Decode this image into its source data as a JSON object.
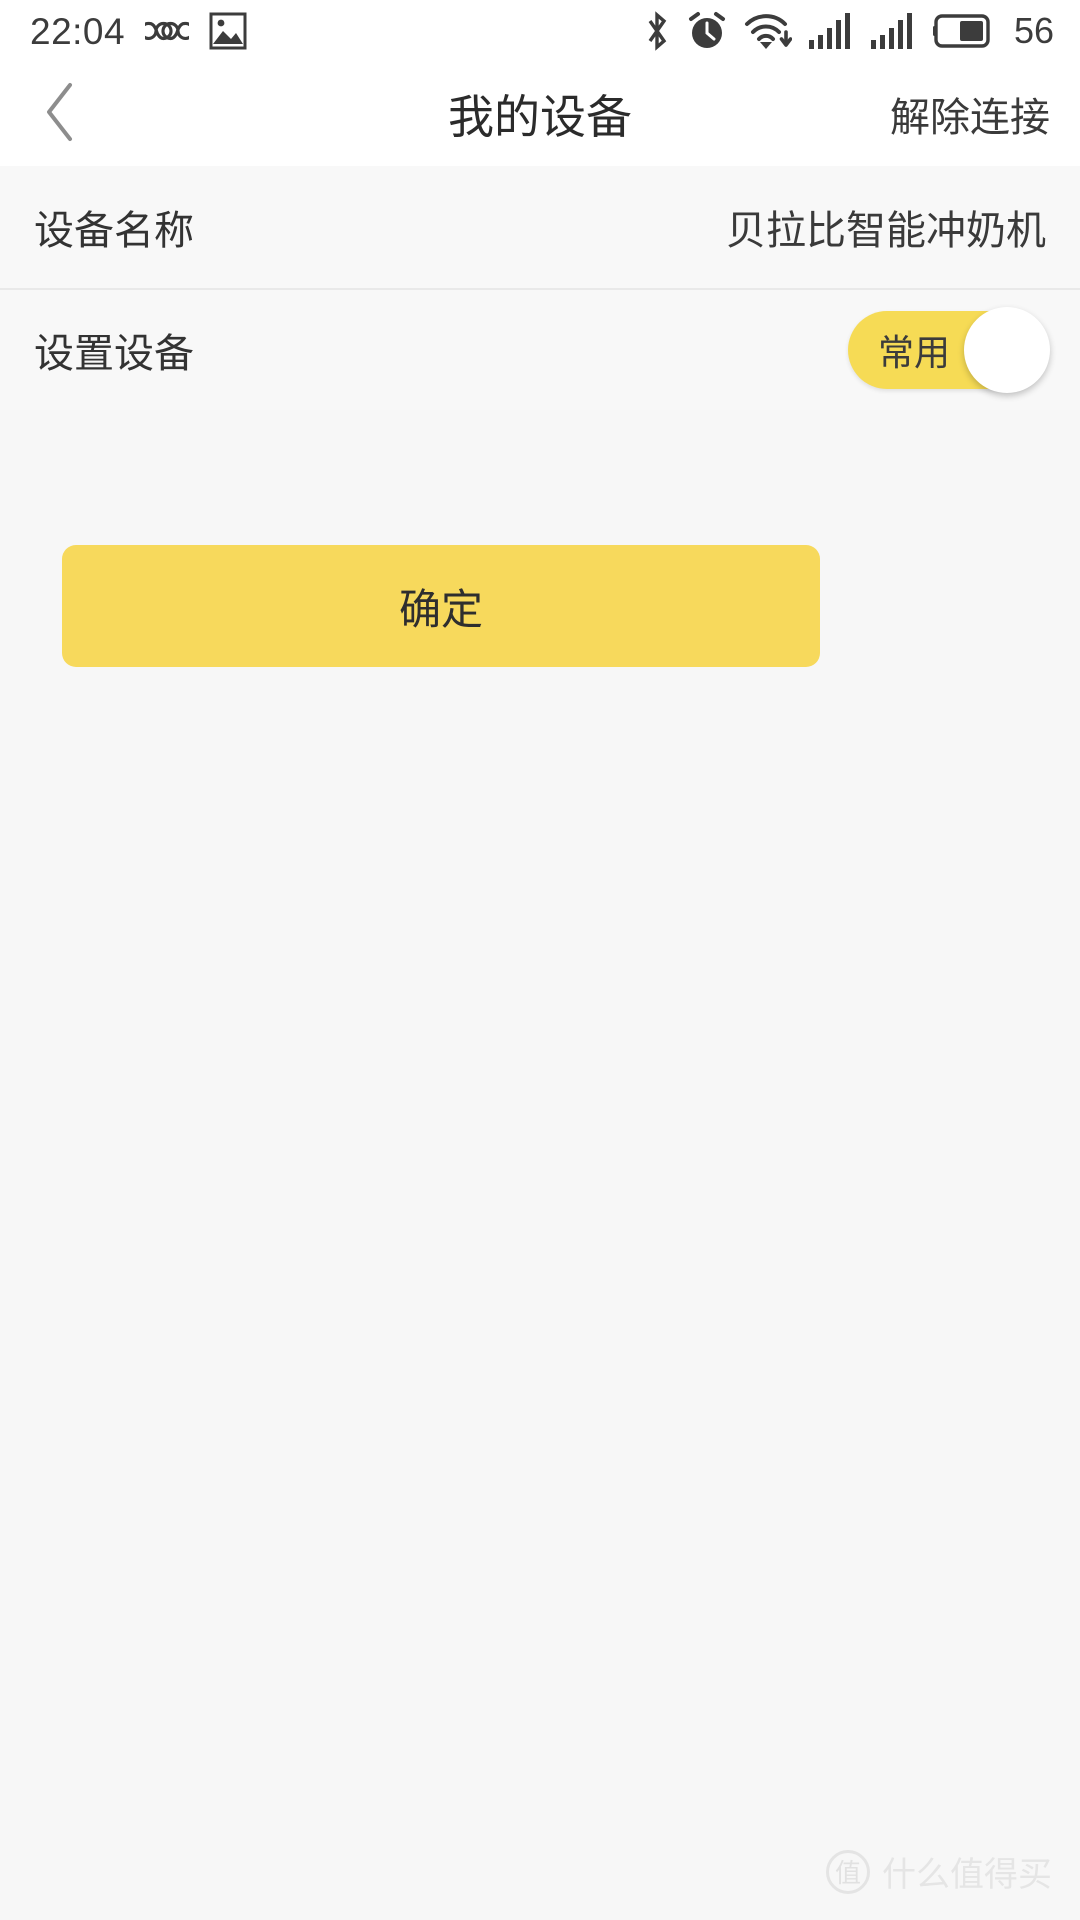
{
  "status_bar": {
    "time": "22:04",
    "left_icons": [
      {
        "name": "infinity-icon",
        "glyph": "∞"
      },
      {
        "name": "image-icon",
        "glyph": "image"
      }
    ],
    "right_icons": [
      {
        "name": "bluetooth-icon"
      },
      {
        "name": "alarm-clock-icon"
      },
      {
        "name": "wifi-download-icon"
      },
      {
        "name": "signal-bars-icon-1"
      },
      {
        "name": "signal-bars-icon-2"
      },
      {
        "name": "battery-icon"
      }
    ],
    "battery_level": "56"
  },
  "header": {
    "back_icon": "chevron-left-icon",
    "title": "我的设备",
    "action_label": "解除连接"
  },
  "rows": [
    {
      "label": "设备名称",
      "value": "贝拉比智能冲奶机",
      "type": "text"
    },
    {
      "label": "设置设备",
      "toggle_label": "常用",
      "toggle_on": true,
      "type": "toggle"
    }
  ],
  "primary_button": {
    "label": "确定"
  },
  "watermark": {
    "logo_text": "值",
    "text": "什么值得买"
  },
  "colors": {
    "accent": "#f7d95c",
    "toggle_on": "#f6db55",
    "page_bg": "#f8f8f8",
    "bar_bg": "#ffffff",
    "text_primary": "#333333"
  }
}
